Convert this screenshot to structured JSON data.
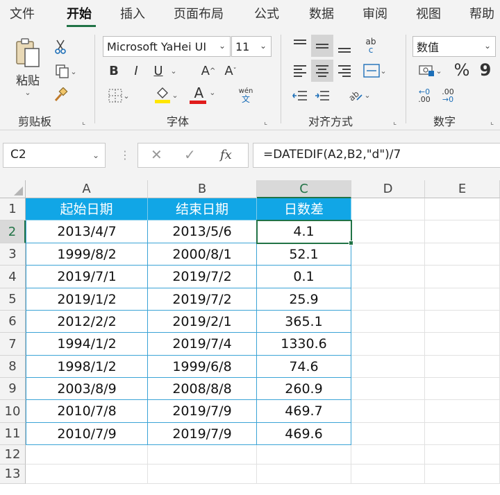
{
  "menu": {
    "tabs": [
      {
        "label": "文件"
      },
      {
        "label": "开始"
      },
      {
        "label": "插入"
      },
      {
        "label": "页面布局"
      },
      {
        "label": "公式"
      },
      {
        "label": "数据"
      },
      {
        "label": "审阅"
      },
      {
        "label": "视图"
      },
      {
        "label": "帮助"
      }
    ],
    "active_tab": "开始"
  },
  "ribbon": {
    "clipboard": {
      "label": "剪贴板",
      "paste_label": "粘贴"
    },
    "font": {
      "label": "字体",
      "font_name": "Microsoft YaHei UI",
      "font_size": "11",
      "bold": "B",
      "italic": "I",
      "underline": "U",
      "grow": "A",
      "shrink": "A",
      "font_color_letter": "A",
      "phonetic_top": "wén",
      "phonetic_bottom": "文",
      "highlight_color": "#ffe600",
      "font_color": "#e01b1b"
    },
    "alignment": {
      "label": "对齐方式",
      "wrap_top": "ab",
      "wrap_bottom": "c"
    },
    "number": {
      "label": "数字",
      "format": "数值",
      "percent": "%",
      "comma": "9",
      "inc_top": "←0",
      "inc_bottom": ".00",
      "dec_top": ".00",
      "dec_bottom": "→0"
    }
  },
  "formula_bar": {
    "name_box": "C2",
    "cancel": "✕",
    "enter": "✓",
    "fx": "fx",
    "formula": "=DATEDIF(A2,B2,\"d\")/7"
  },
  "sheet": {
    "columns": [
      "A",
      "B",
      "C",
      "D",
      "E"
    ],
    "row_numbers": [
      "1",
      "2",
      "3",
      "4",
      "5",
      "6",
      "7",
      "8",
      "9",
      "10",
      "11",
      "12",
      "13"
    ],
    "selected_cell": "C2",
    "header_fill": "#11a6e6",
    "headers": [
      "起始日期",
      "结束日期",
      "日数差"
    ],
    "rows": [
      [
        "2013/4/7",
        "2013/5/6",
        "4.1"
      ],
      [
        "1999/8/2",
        "2000/8/1",
        "52.1"
      ],
      [
        "2019/7/1",
        "2019/7/2",
        "0.1"
      ],
      [
        "2019/1/2",
        "2019/7/2",
        "25.9"
      ],
      [
        "2012/2/2",
        "2019/2/1",
        "365.1"
      ],
      [
        "1994/1/2",
        "2019/7/4",
        "1330.6"
      ],
      [
        "1998/1/2",
        "1999/6/8",
        "74.6"
      ],
      [
        "2003/8/9",
        "2008/8/8",
        "260.9"
      ],
      [
        "2010/7/8",
        "2019/7/9",
        "469.7"
      ],
      [
        "2010/7/9",
        "2019/7/9",
        "469.6"
      ]
    ]
  }
}
